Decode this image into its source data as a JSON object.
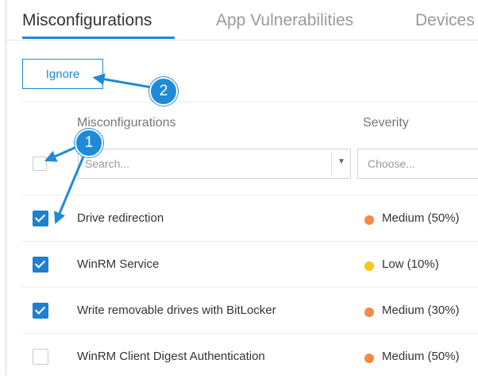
{
  "tabs": [
    {
      "label": "Misconfigurations",
      "active": true
    },
    {
      "label": "App Vulnerabilities",
      "active": false
    },
    {
      "label": "Devices",
      "active": false
    }
  ],
  "toolbar": {
    "ignore_label": "Ignore"
  },
  "columns": {
    "name": "Misconfigurations",
    "severity": "Severity"
  },
  "filters": {
    "search_placeholder": "Search...",
    "choose_placeholder": "Choose..."
  },
  "rows": [
    {
      "name": "Drive redirection",
      "severity": "Medium (50%)",
      "checked": true,
      "color": "#f28b44"
    },
    {
      "name": "WinRM Service",
      "severity": "Low (10%)",
      "checked": true,
      "color": "#f6c71b"
    },
    {
      "name": "Write removable drives with BitLocker",
      "severity": "Medium (30%)",
      "checked": true,
      "color": "#f28b44"
    },
    {
      "name": "WinRM Client Digest Authentication",
      "severity": "Medium (50%)",
      "checked": false,
      "color": "#f28b44"
    }
  ],
  "annotations": {
    "one": "1",
    "two": "2"
  },
  "colors": {
    "accent": "#1f8ad6"
  }
}
